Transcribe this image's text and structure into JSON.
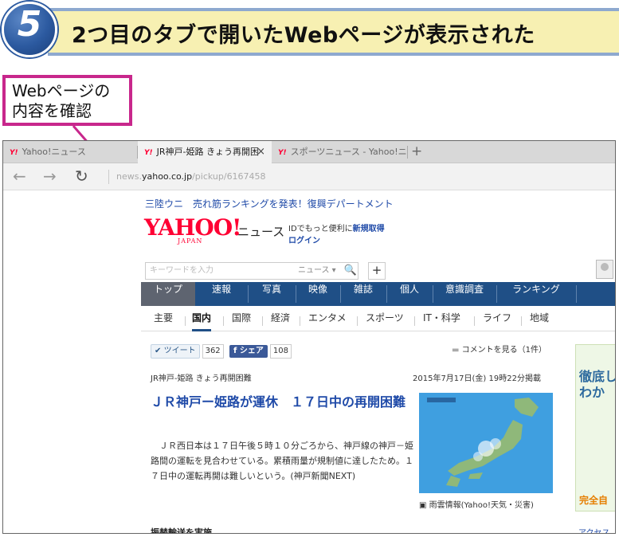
{
  "step": {
    "number": "5",
    "title": "2つ目のタブで開いたWebページが表示された"
  },
  "callout": {
    "line1": "Webページの",
    "line2": "内容を確認"
  },
  "browser": {
    "tabs": [
      {
        "icon": "Y!",
        "label": "Yahoo!ニュース"
      },
      {
        "icon": "Y!",
        "label": "JR神戸-姫路 きょう再開困",
        "close": "×"
      },
      {
        "icon": "Y!",
        "label": "スポーツニュース - Yahoo!ニュース"
      }
    ],
    "new_tab": "+",
    "nav": {
      "back": "←",
      "forward": "→",
      "refresh": "↻"
    },
    "url": {
      "prefix": "news.",
      "host": "yahoo.co.jp",
      "path": "/pickup/6167458"
    }
  },
  "page": {
    "promo": "三陸ウニ　売れ筋ランキングを発表！復興デパートメント",
    "logo": {
      "main": "YAHOO!",
      "sub": "JAPAN",
      "section": "ニュース"
    },
    "id_prompt": "IDでもっと便利に",
    "signup": "新規取得",
    "login": "ログイン",
    "search": {
      "placeholder": "キーワードを入力",
      "scope": "ニュース ▾",
      "search_icon": "🔍",
      "add": "+"
    },
    "nav": [
      "トップ",
      "速報",
      "写真",
      "映像",
      "雑誌",
      "個人",
      "意識調査",
      "ランキング"
    ],
    "subnav": [
      "主要",
      "国内",
      "国際",
      "経済",
      "エンタメ",
      "スポーツ",
      "IT・科学",
      "ライフ",
      "地域"
    ],
    "subnav_active": "国内",
    "tweet": {
      "label": "ツイート",
      "count": "362"
    },
    "share": {
      "label": "シェア",
      "count": "108"
    },
    "comments": "コメントを見る（1件）",
    "article": {
      "category": "JR神戸-姫路 きょう再開困難",
      "date": "2015年7月17日(金) 19時22分掲載",
      "headline": "ＪＲ神戸ー姫路が運休　１７日中の再開困難",
      "body": "　ＪＲ西日本は１７日午後５時１０分ごろから、神戸線の神戸－姫路間の運転を見合わせている。累積雨量が規制値に達したため。１７日中の運転再開は難しいという。(神戸新聞NEXT)",
      "map_caption": "雨雲情報(Yahoo!天気・災害)",
      "next_heading": "振替輸送を実施"
    },
    "ad": {
      "text1": "徹底し",
      "text2": "わか",
      "foot": "完全自",
      "next": "アクセス"
    }
  },
  "colors": {
    "yahoo_red": "#ff0033",
    "nav_blue": "#1f4f86",
    "link_blue": "#1f4aa8",
    "callout_magenta": "#c8278c",
    "step_blue": "#2c5aa0",
    "step_banner": "#f7f0b2"
  }
}
